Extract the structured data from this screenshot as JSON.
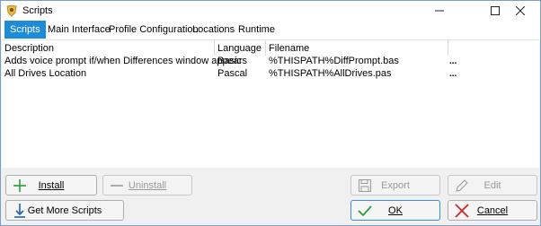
{
  "window": {
    "title": "Scripts",
    "icon": "pig-icon",
    "controls": {
      "minimize": "—",
      "maximize": "☐",
      "close": "✕"
    }
  },
  "tabs": [
    {
      "label": "Scripts",
      "active": true
    },
    {
      "label": "Main Interface",
      "active": false
    },
    {
      "label": "Profile Configuration",
      "active": false
    },
    {
      "label": "Locations",
      "active": false
    },
    {
      "label": "Runtime",
      "active": false
    }
  ],
  "list": {
    "columns": [
      "Description",
      "Language",
      "Filename",
      ""
    ],
    "rows": [
      {
        "description": "Adds voice prompt if/when Differences window appears",
        "language": "Basic",
        "filename": "%THISPATH%DiffPrompt.bas",
        "more": "..."
      },
      {
        "description": "All Drives Location",
        "language": "Pascal",
        "filename": "%THISPATH%AllDrives.pas",
        "more": "..."
      }
    ]
  },
  "buttons": {
    "install": "Install",
    "uninstall": "Uninstall",
    "export": "Export",
    "edit": "Edit",
    "get_more": "Get More Scripts",
    "ok": "OK",
    "cancel": "Cancel"
  },
  "colors": {
    "accent": "#1e8bd8",
    "install_icon": "#2a9d3a",
    "get_more_icon": "#1e5fb3",
    "ok_icon": "#2a9d3a",
    "cancel_icon": "#d02828"
  }
}
